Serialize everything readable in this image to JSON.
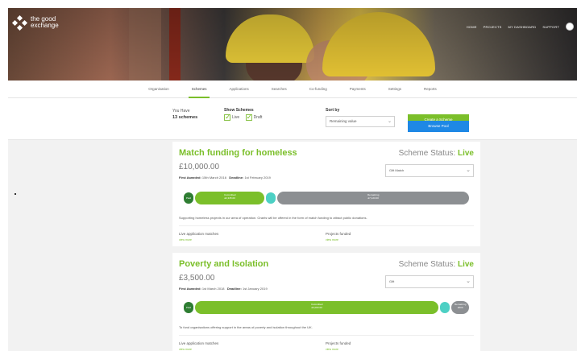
{
  "app": {
    "logo_text": "the good\nexchange",
    "brand_green": "#7bbf2a",
    "brand_blue": "#1e88e5"
  },
  "topnav": [
    "Home",
    "Projects",
    "My Dashboard",
    "Support"
  ],
  "tabs": [
    {
      "label": "Organisation",
      "active": false
    },
    {
      "label": "Schemes",
      "active": true
    },
    {
      "label": "Applications",
      "active": false
    },
    {
      "label": "Searches",
      "active": false
    },
    {
      "label": "Co-funding",
      "active": false
    },
    {
      "label": "Payments",
      "active": false
    },
    {
      "label": "Settings",
      "active": false
    },
    {
      "label": "Reports",
      "active": false
    }
  ],
  "filters": {
    "you_have_label": "You Have",
    "scheme_count": "13 schemes",
    "show_label": "Show Schemes",
    "show_live": "Live",
    "show_draft": "Draft",
    "sort_label": "Sort by",
    "sort_value": "Remaining value",
    "create_button": "Create a Scheme",
    "secondary_button": "Browse Pool"
  },
  "schemes": [
    {
      "title": "Match funding for homeless",
      "status_prefix": "Scheme Status:",
      "status": "Live",
      "amount": "£10,000.00",
      "first_awarded": "First Awarded:",
      "first_awarded_value": "15th March 2016",
      "deadline": "Deadline:",
      "deadline_value": "1st February 2019",
      "select_value": "Gift Match",
      "timeline": {
        "paid_label": "Paid",
        "committed_label": "Committed",
        "committed_value": "£2,345.00",
        "remaining_label": "Remaining",
        "remaining_value": "£7,123.00",
        "committed_fraction": 0.24,
        "remaining_fraction": 0.66
      },
      "description": "Supporting homeless projects in our area of operation. Grants will be offered in the form of match funding to attract public donations.",
      "matches_label": "Live application matches",
      "matches_link": "view more",
      "funded_label": "Projects funded",
      "funded_link": "view more"
    },
    {
      "title": "Poverty and Isolation",
      "status_prefix": "Scheme Status:",
      "status": "Live",
      "amount": "£3,500.00",
      "first_awarded": "First Awarded:",
      "first_awarded_value": "1st March 2018",
      "deadline": "Deadline:",
      "deadline_value": "1st January 2019",
      "select_value": "Gift",
      "timeline": {
        "paid_label": "Paid",
        "committed_label": "Committed",
        "committed_value": "£3,000.00",
        "remaining_label": "Remaining",
        "remaining_value": "£500",
        "committed_fraction": 0.84,
        "remaining_fraction": 0.06
      },
      "description": "To fund organisations offering support in the areas of poverty and isolation throughout the UK.",
      "matches_label": "Live application matches",
      "matches_link": "view more",
      "funded_label": "Projects funded",
      "funded_link": "view more"
    }
  ]
}
